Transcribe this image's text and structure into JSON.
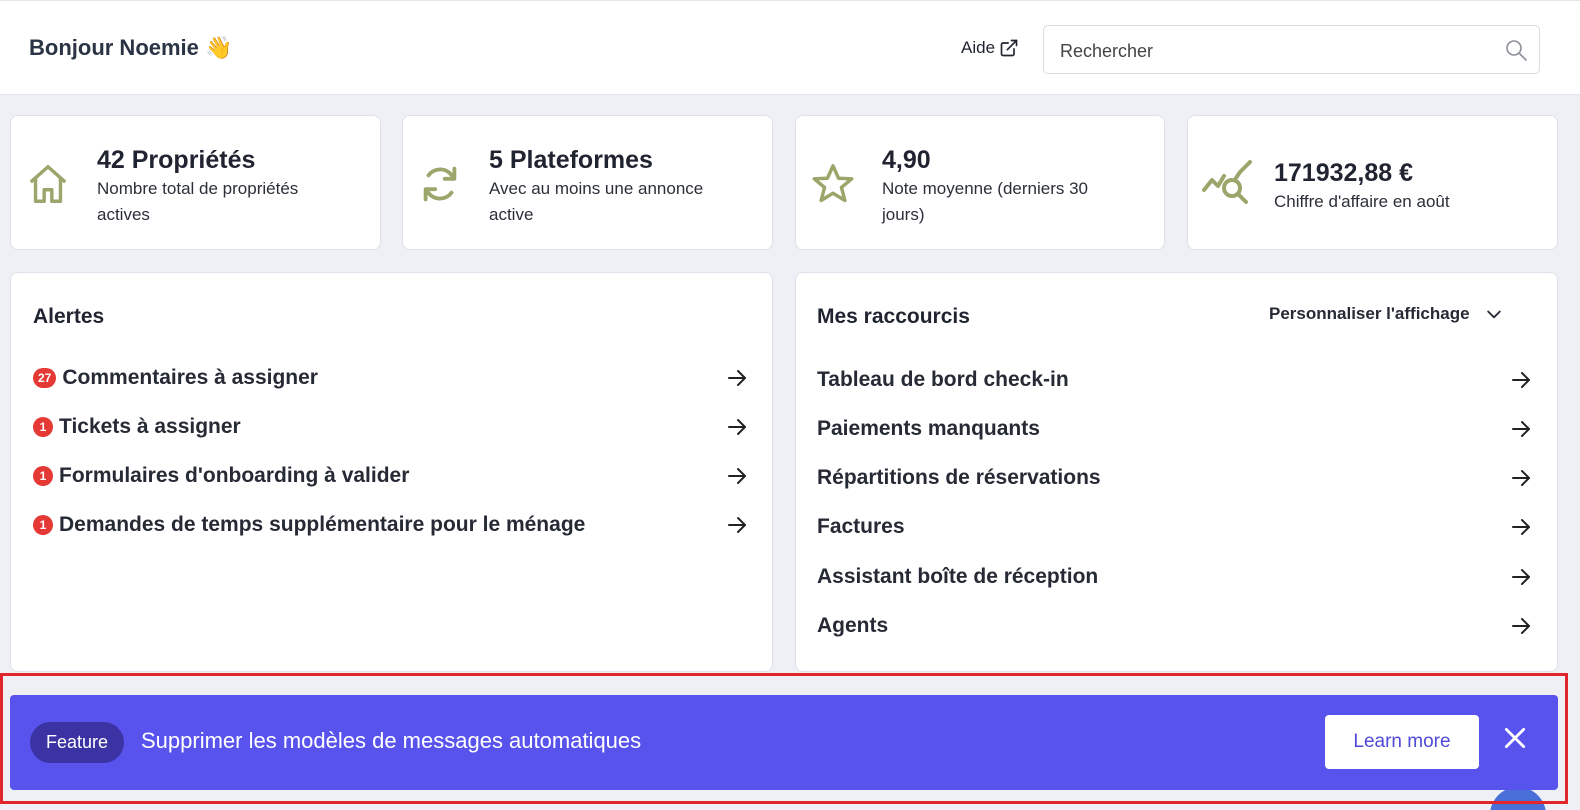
{
  "header": {
    "greeting": "Bonjour Noemie",
    "greeting_emoji": "👋",
    "help_label": "Aide",
    "search_placeholder": "Rechercher"
  },
  "stats": [
    {
      "icon": "home-icon",
      "title": "42 Propriétés",
      "subtitle_lines": [
        "Nombre total de propriétés",
        "actives"
      ]
    },
    {
      "icon": "sync-icon",
      "title": "5 Plateformes",
      "subtitle_lines": [
        "Avec au moins une annonce",
        "active"
      ]
    },
    {
      "icon": "star-icon",
      "title": "4,90",
      "subtitle_lines": [
        "Note moyenne (derniers 30",
        "jours)"
      ]
    },
    {
      "icon": "analytics-icon",
      "title": "171932,88 €",
      "subtitle_lines": [
        "Chiffre d'affaire en août"
      ]
    }
  ],
  "alerts": {
    "title": "Alertes",
    "items": [
      {
        "badge": "27",
        "label": "Commentaires à assigner"
      },
      {
        "badge": "1",
        "label": "Tickets à assigner"
      },
      {
        "badge": "1",
        "label": "Formulaires d'onboarding à valider"
      },
      {
        "badge": "1",
        "label": "Demandes de temps supplémentaire pour le ménage"
      }
    ]
  },
  "shortcuts": {
    "title": "Mes raccourcis",
    "customize_label": "Personnaliser l'affichage",
    "items": [
      {
        "label": "Tableau de bord check-in"
      },
      {
        "label": "Paiements manquants"
      },
      {
        "label": "Répartitions de réservations"
      },
      {
        "label": "Factures"
      },
      {
        "label": "Assistant boîte de réception"
      },
      {
        "label": "Agents"
      }
    ]
  },
  "banner": {
    "tag": "Feature",
    "message": "Supprimer les modèles de messages automatiques",
    "cta_label": "Learn more",
    "background_color": "#5853ec"
  },
  "colors": {
    "icon_accent": "#9aa66a",
    "badge": "#e53935",
    "page_bg": "#eef0f6"
  }
}
